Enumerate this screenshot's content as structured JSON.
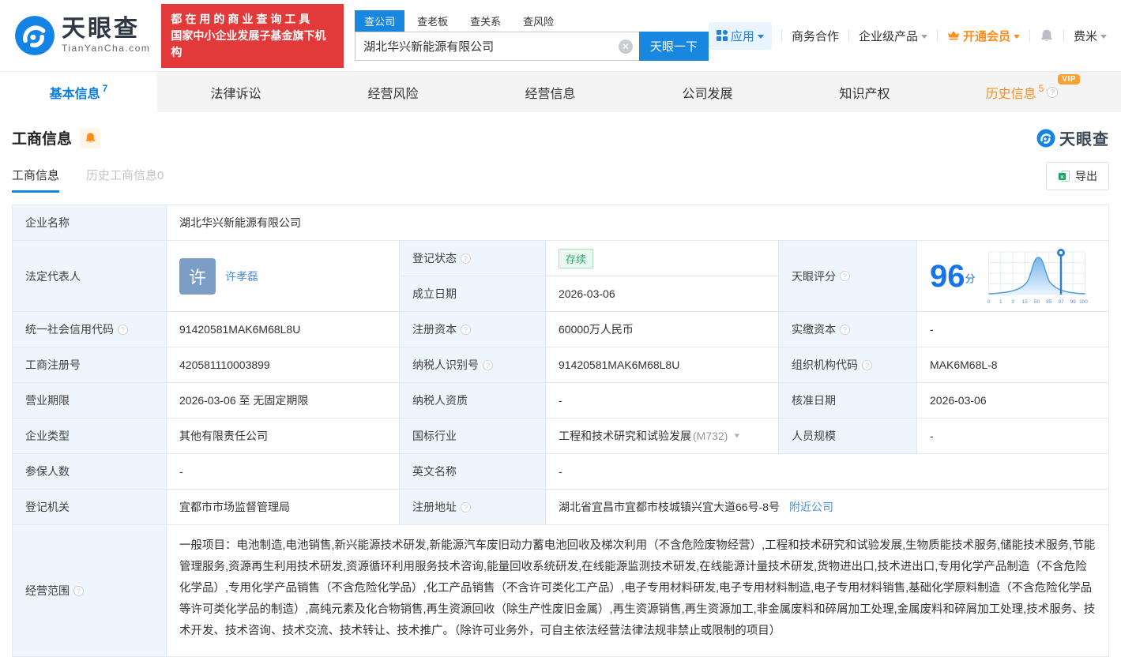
{
  "header": {
    "logo": {
      "brand": "天眼查",
      "domain": "TianYanCha.com"
    },
    "banner": {
      "line1": "都在用的商业查询工具",
      "line2": "国家中小企业发展子基金旗下机构"
    },
    "search": {
      "tabs": [
        {
          "label": "查公司",
          "active": true
        },
        {
          "label": "查老板",
          "active": false
        },
        {
          "label": "查关系",
          "active": false
        },
        {
          "label": "查风险",
          "active": false
        }
      ],
      "value": "湖北华兴新能源有限公司",
      "button": "天眼一下"
    },
    "nav": {
      "apps": "应用",
      "cooperation": "商务合作",
      "enterprise": "企业级产品",
      "vip": "开通会员",
      "user": "费米"
    }
  },
  "tabbar": {
    "tabs": [
      {
        "label": "基本信息",
        "count": "7"
      },
      {
        "label": "法律诉讼"
      },
      {
        "label": "经营风险"
      },
      {
        "label": "经营信息"
      },
      {
        "label": "公司发展"
      },
      {
        "label": "知识产权"
      },
      {
        "label": "历史信息",
        "count": "5",
        "vip_badge": "VIP"
      }
    ]
  },
  "section": {
    "title": "工商信息",
    "watermark": "天眼查",
    "subtabs": [
      {
        "label": "工商信息",
        "active": true
      },
      {
        "label": "历史工商信息0",
        "active": false
      }
    ],
    "export_label": "导出"
  },
  "table": {
    "company_name": {
      "label": "企业名称",
      "value": "湖北华兴新能源有限公司"
    },
    "legal_rep": {
      "label": "法定代表人",
      "avatar_char": "许",
      "name": "许孝磊"
    },
    "reg_status": {
      "label": "登记状态",
      "value": "存续"
    },
    "establish_date": {
      "label": "成立日期",
      "value": "2026-03-06"
    },
    "score": {
      "label": "天眼评分",
      "value": "96",
      "unit": "分"
    },
    "credit_code": {
      "label": "统一社会信用代码",
      "value": "91420581MAK6M68L8U"
    },
    "reg_capital": {
      "label": "注册资本",
      "value": "60000万人民币"
    },
    "paid_capital": {
      "label": "实缴资本",
      "value": "-"
    },
    "reg_number": {
      "label": "工商注册号",
      "value": "420581110003899"
    },
    "taxpayer_id": {
      "label": "纳税人识别号",
      "value": "91420581MAK6M68L8U"
    },
    "org_code": {
      "label": "组织机构代码",
      "value": "MAK6M68L-8"
    },
    "business_term": {
      "label": "营业期限",
      "value": "2026-03-06 至 无固定期限"
    },
    "taxpayer_quality": {
      "label": "纳税人资质",
      "value": "-"
    },
    "approval_date": {
      "label": "核准日期",
      "value": "2026-03-06"
    },
    "company_type": {
      "label": "企业类型",
      "value": "其他有限责任公司"
    },
    "industry": {
      "label": "国标行业",
      "value": "工程和技术研究和试验发展",
      "code": "(M732)"
    },
    "staff_size": {
      "label": "人员规模",
      "value": "-"
    },
    "insured_count": {
      "label": "参保人数",
      "value": "-"
    },
    "english_name": {
      "label": "英文名称",
      "value": "-"
    },
    "reg_authority": {
      "label": "登记机关",
      "value": "宜都市市场监督管理局"
    },
    "reg_address": {
      "label": "注册地址",
      "value": "湖北省宜昌市宜都市枝城镇兴宜大道66号-8号",
      "link": "附近公司"
    },
    "business_scope": {
      "label": "经营范围",
      "value": "一般项目：电池制造,电池销售,新兴能源技术研发,新能源汽车废旧动力蓄电池回收及梯次利用（不含危险废物经营）,工程和技术研究和试验发展,生物质能技术服务,储能技术服务,节能管理服务,资源再生利用技术研发,资源循环利用服务技术咨询,能量回收系统研发,在线能源监测技术研发,在线能源计量技术研发,货物进出口,技术进出口,专用化学产品制造（不含危险化学品）,专用化学产品销售（不含危险化学品）,化工产品销售（不含许可类化工产品）,电子专用材料研发,电子专用材料制造,电子专用材料销售,基础化学原料制造（不含危险化学品等许可类化学品的制造）,高纯元素及化合物销售,再生资源回收（除生产性废旧金属）,再生资源销售,再生资源加工,非金属废料和碎屑加工处理,金属废料和碎屑加工处理,技术服务、技术开发、技术咨询、技术交流、技术转让、技术推广。（除许可业务外，可自主依法经营法律法规非禁止或限制的项目）"
    }
  },
  "chart_data": {
    "type": "area",
    "title": "天眼评分分布曲线",
    "score": 96,
    "score_unit": "分",
    "marker_x": 97,
    "x_ticks": [
      "0",
      "1",
      "3",
      "15",
      "50",
      "85",
      "97",
      "99",
      "100"
    ],
    "curve_shape": "bell curve peaking near tick 50, marker pin at 97",
    "grid": true
  },
  "colors": {
    "accent_blue": "#1787e0",
    "link_blue": "#4e8fd6",
    "banner_red": "#e23a3a",
    "vip_orange": "#ff8d1a",
    "status_green": "#2ba868",
    "label_cell_bg": "#eef6fd",
    "score_blue": "#1673e8"
  }
}
